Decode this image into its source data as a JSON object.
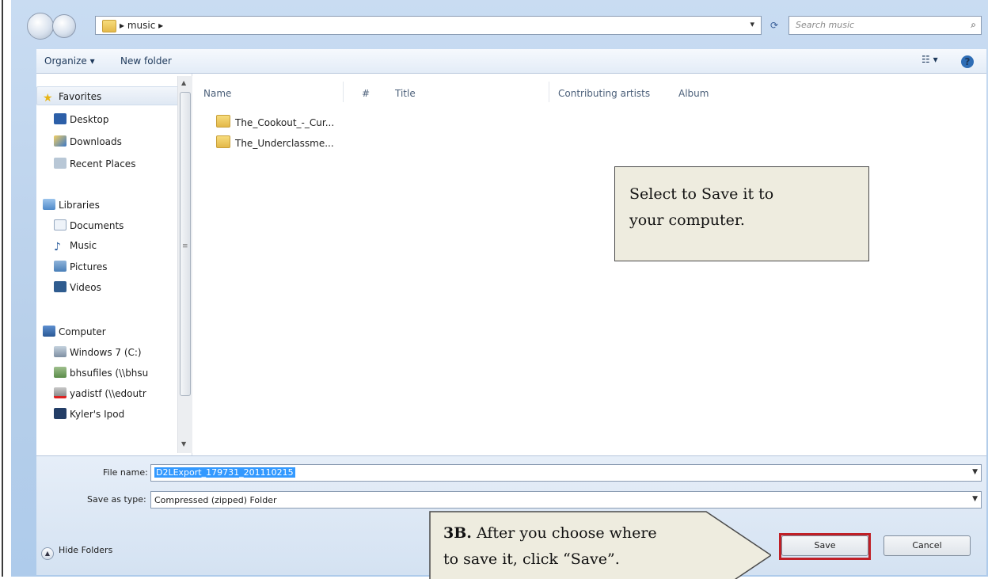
{
  "address": {
    "crumb": "▸ music ▸",
    "dropdown": "▾",
    "refresh": "⟳",
    "search_placeholder": "Search music",
    "search_icon": "⌕"
  },
  "toolbar": {
    "organize_label": "Organize ▾",
    "new_folder_label": "New folder",
    "views_label": "☷ ▾",
    "help_label": "?"
  },
  "nav": {
    "favorites": "Favorites",
    "desktop": "Desktop",
    "downloads": "Downloads",
    "recent_places": "Recent Places",
    "libraries": "Libraries",
    "documents": "Documents",
    "music": "Music",
    "pictures": "Pictures",
    "videos": "Videos",
    "computer": "Computer",
    "windows7": "Windows 7 (C:)",
    "bhsufiles": "bhsufiles (\\\\bhsu",
    "yadistf": "yadistf (\\\\edoutr",
    "kylers_ipod": "Kyler's Ipod"
  },
  "columns": {
    "name": "Name",
    "number": "#",
    "title": "Title",
    "contributing_artists": "Contributing artists",
    "album": "Album"
  },
  "files": [
    {
      "name": "The_Cookout_-_Cur..."
    },
    {
      "name": "The_Underclassme..."
    }
  ],
  "callout_top": {
    "line1": "Select to Save it to",
    "line2": "your computer."
  },
  "form": {
    "file_name_label": "File name:",
    "file_name_value": "D2LExport_179731_201110215",
    "save_type_label": "Save as type:",
    "save_type_value": "Compressed (zipped) Folder",
    "hide_folders_label": "Hide Folders",
    "save_label": "Save",
    "cancel_label": "Cancel"
  },
  "callout_bottom": {
    "bold": "3B.",
    "line1": " After you choose where",
    "line2": "to save it, click “Save”."
  },
  "colors": {
    "accent_red": "#c01f26",
    "selection_blue": "#3399ff",
    "callout_bg": "#eeecdf"
  }
}
